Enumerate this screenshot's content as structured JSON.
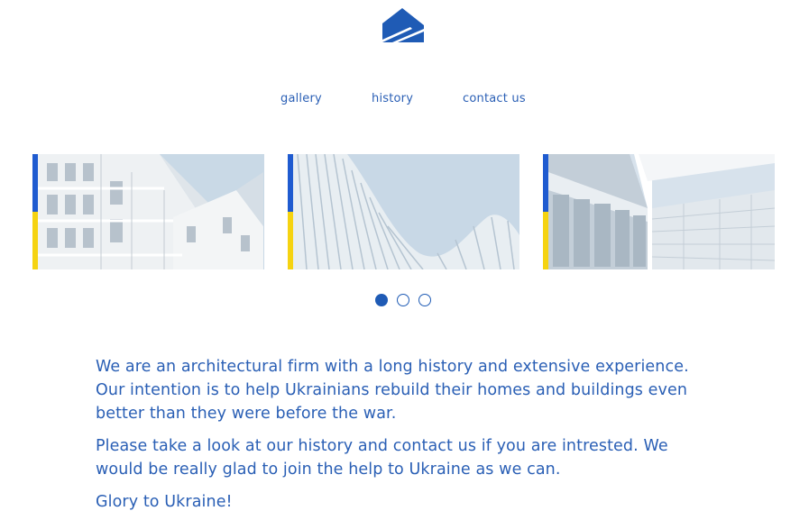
{
  "logo": {
    "icon": "house-roof-logo-icon",
    "color": "#1f5bb5"
  },
  "nav": {
    "items": [
      {
        "label": "gallery"
      },
      {
        "label": "history"
      },
      {
        "label": "contact us"
      }
    ]
  },
  "carousel": {
    "slides": [
      {
        "image": "white-apartment-building-photo"
      },
      {
        "image": "curved-white-facade-photo"
      },
      {
        "image": "glass-skyscraper-photo"
      }
    ],
    "stripe_colors": {
      "blue": "#1f5bd0",
      "yellow": "#f5d311"
    },
    "pagination": {
      "count": 3,
      "active": 1
    }
  },
  "content": {
    "paragraphs": [
      "We are an architectural firm with a long history and extensive experience. Our intention is to help Ukrainians rebuild their homes and buildings even better than they were before the war.",
      "Please take a look at our history and contact us if you are intrested. We would be really glad to join the help to Ukraine as we can.",
      "Glory to Ukraine!"
    ]
  },
  "colors": {
    "text": "#2a5fb5",
    "accent": "#1f5bb5"
  }
}
